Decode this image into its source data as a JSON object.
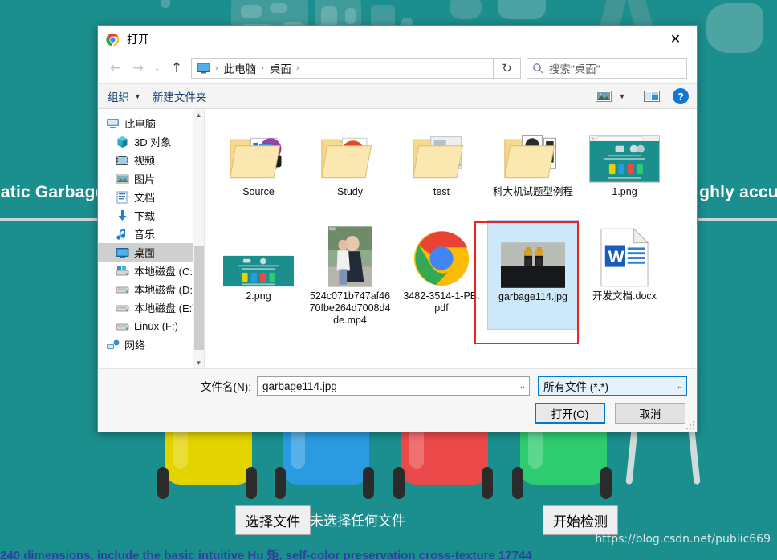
{
  "background": {
    "page_title_left": "matic Garbage",
    "page_title_right": "ghly accura",
    "choose_file_label": "选择文件",
    "no_file_text": "未选择任何文件",
    "start_detect_label": "开始检测",
    "watermark": "https://blog.csdn.net/public669",
    "cut_text": "240 dimensions, include the basic intuitive Hu 矩, self-color preservation cross-texture 17744",
    "teal": "#1b8e8e",
    "bins": [
      {
        "name": "yellow-bin",
        "color": "#e3d400",
        "lid": "#d6c800"
      },
      {
        "name": "blue-bin",
        "color": "#2a9be0",
        "lid": "#1f8ed2"
      },
      {
        "name": "red-bin",
        "color": "#ec4a4a",
        "lid": "#e03b3b"
      },
      {
        "name": "green-bin",
        "color": "#2ecc71",
        "lid": "#25bb65"
      }
    ]
  },
  "dialog": {
    "title": "打开",
    "app_icon": "chrome-icon",
    "close_label": "✕",
    "nav": {
      "back_glyph": "←",
      "forward_glyph": "→",
      "history_glyph": "⌄",
      "up_glyph": "↑",
      "breadcrumbs": [
        "此电脑",
        "桌面"
      ],
      "breadcrumb_sep": "›",
      "refresh_glyph": "↻",
      "search_placeholder": "搜索\"桌面\""
    },
    "toolbar": {
      "organize_label": "组织",
      "organize_caret": "▼",
      "new_folder_label": "新建文件夹",
      "view_caret": "▼",
      "help_label": "?"
    },
    "sidebar": {
      "items": [
        {
          "label": "此电脑",
          "icon": "computer-icon",
          "indent": false,
          "selected": false
        },
        {
          "label": "3D 对象",
          "icon": "3d-objects-icon",
          "indent": true,
          "selected": false
        },
        {
          "label": "视频",
          "icon": "videos-icon",
          "indent": true,
          "selected": false
        },
        {
          "label": "图片",
          "icon": "pictures-icon",
          "indent": true,
          "selected": false
        },
        {
          "label": "文档",
          "icon": "documents-icon",
          "indent": true,
          "selected": false
        },
        {
          "label": "下载",
          "icon": "downloads-icon",
          "indent": true,
          "selected": false
        },
        {
          "label": "音乐",
          "icon": "music-icon",
          "indent": true,
          "selected": false
        },
        {
          "label": "桌面",
          "icon": "desktop-icon",
          "indent": true,
          "selected": true
        },
        {
          "label": "本地磁盘 (C:)",
          "icon": "system-drive-icon",
          "indent": true,
          "selected": false
        },
        {
          "label": "本地磁盘 (D:)",
          "icon": "drive-icon",
          "indent": true,
          "selected": false
        },
        {
          "label": "本地磁盘 (E:)",
          "icon": "drive-icon",
          "indent": true,
          "selected": false
        },
        {
          "label": "Linux (F:)",
          "icon": "drive-icon",
          "indent": true,
          "selected": false
        },
        {
          "label": "网络",
          "icon": "network-icon",
          "indent": false,
          "selected": false
        }
      ]
    },
    "files": [
      {
        "name": "Source",
        "type": "folder",
        "thumb": "folder-doc-rar-thumb",
        "selected": false
      },
      {
        "name": "Study",
        "type": "folder",
        "thumb": "folder-chrome-thumb",
        "selected": false
      },
      {
        "name": "test",
        "type": "folder",
        "thumb": "folder-photo-thumb",
        "selected": false
      },
      {
        "name": "科大机试题型例程",
        "type": "folder",
        "thumb": "folder-book-thumb",
        "selected": false
      },
      {
        "name": "1.png",
        "type": "image",
        "thumb": "webpage-screenshot-thumb",
        "selected": false
      },
      {
        "name": "2.png",
        "type": "image",
        "thumb": "webpage-banner-thumb",
        "selected": false
      },
      {
        "name": "524c071b747af4670fbe264d7008d4de.mp4",
        "type": "video",
        "thumb": "video-frame-thumb",
        "selected": false
      },
      {
        "name": "3482-3514-1-PB.pdf",
        "type": "pdf",
        "thumb": "chrome-icon-thumb",
        "selected": false
      },
      {
        "name": "garbage114.jpg",
        "type": "image",
        "thumb": "batteries-photo-thumb",
        "selected": true
      },
      {
        "name": "开发文档.docx",
        "type": "document",
        "thumb": "word-doc-thumb",
        "selected": false
      }
    ],
    "form": {
      "filename_label": "文件名(N):",
      "filename_value": "garbage114.jpg",
      "filter_value": "所有文件 (*.*)",
      "open_label": "打开(O)",
      "cancel_label": "取消",
      "dropdown_caret": "⌄"
    },
    "accent": "#0078d7",
    "selection_color": "#cde8f9",
    "annotation_color": "#ee2222"
  }
}
